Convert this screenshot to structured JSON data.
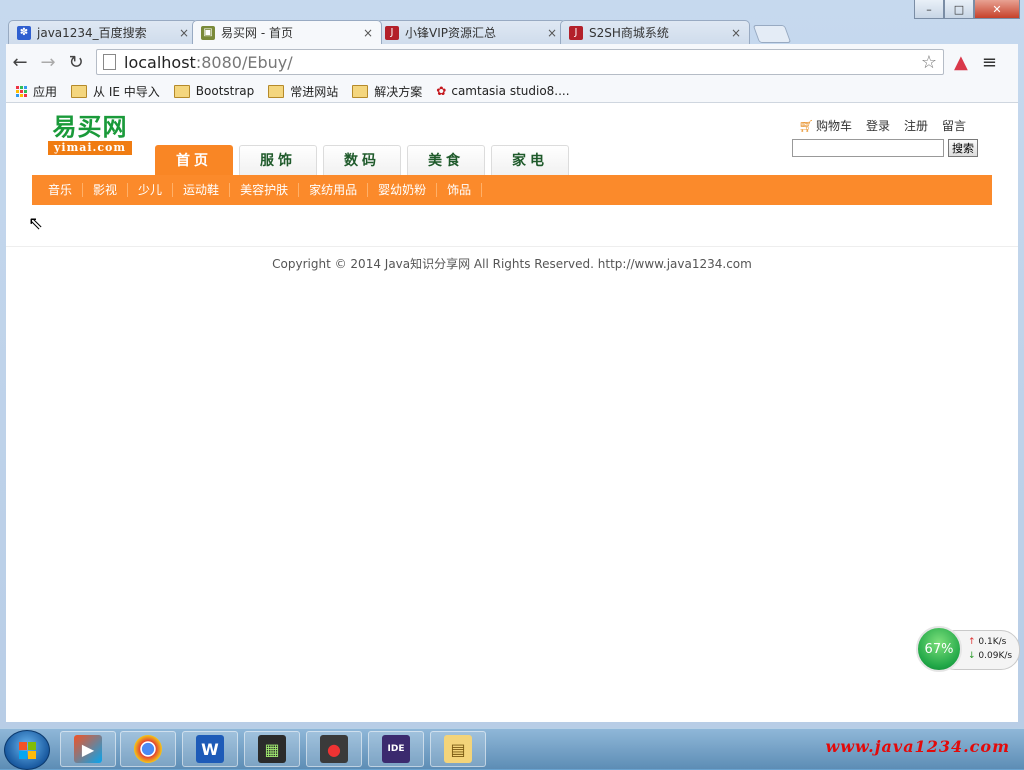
{
  "browser": {
    "tabs": [
      {
        "title": "java1234_百度搜索",
        "favicon": "baidu-paw-icon",
        "active": false
      },
      {
        "title": "易买网 - 首页",
        "favicon": "image-icon",
        "active": true
      },
      {
        "title": "小锋VIP资源汇总",
        "favicon": "j-icon",
        "active": false
      },
      {
        "title": "S2SH商城系统",
        "favicon": "j-icon",
        "active": false
      }
    ],
    "close_glyph": "×",
    "url_host": "localhost",
    "url_rest": ":8080/Ebuy/",
    "bookmarks": [
      {
        "label": "应用",
        "icon": "apps-grid-icon"
      },
      {
        "label": "从 IE 中导入",
        "icon": "folder-icon"
      },
      {
        "label": "Bootstrap",
        "icon": "folder-icon"
      },
      {
        "label": "常进网站",
        "icon": "folder-icon"
      },
      {
        "label": "解决方案",
        "icon": "folder-icon"
      },
      {
        "label": "camtasia studio8....",
        "icon": "camtasia-icon"
      }
    ]
  },
  "site": {
    "logo_cn": "易买网",
    "logo_en": "yimai.com",
    "top_links": [
      "购物车",
      "登录",
      "注册",
      "留言"
    ],
    "search_button": "搜索",
    "search_value": "",
    "main_nav": [
      "首页",
      "服饰",
      "数码",
      "美食",
      "家电"
    ],
    "active_nav_index": 0,
    "sub_nav": [
      "音乐",
      "影视",
      "少儿",
      "运动鞋",
      "美容护肤",
      "家纺用品",
      "婴幼奶粉",
      "饰品"
    ],
    "footer": "Copyright © 2014 Java知识分享网 All Rights Reserved. http://www.java1234.com"
  },
  "net_widget": {
    "percent": "67%",
    "up_rate": "0.1K/s",
    "down_rate": "0.09K/s"
  },
  "taskbar": {
    "apps": [
      "windows-media-icon",
      "chrome-icon",
      "wps-writer-icon",
      "terminal-icon",
      "recorder-icon",
      "javaee-ide-icon",
      "explorer-icon"
    ],
    "watermark": "www.java1234.com"
  },
  "colors": {
    "accent_orange": "#fb8a2b",
    "logo_green": "#1a9a3a"
  }
}
